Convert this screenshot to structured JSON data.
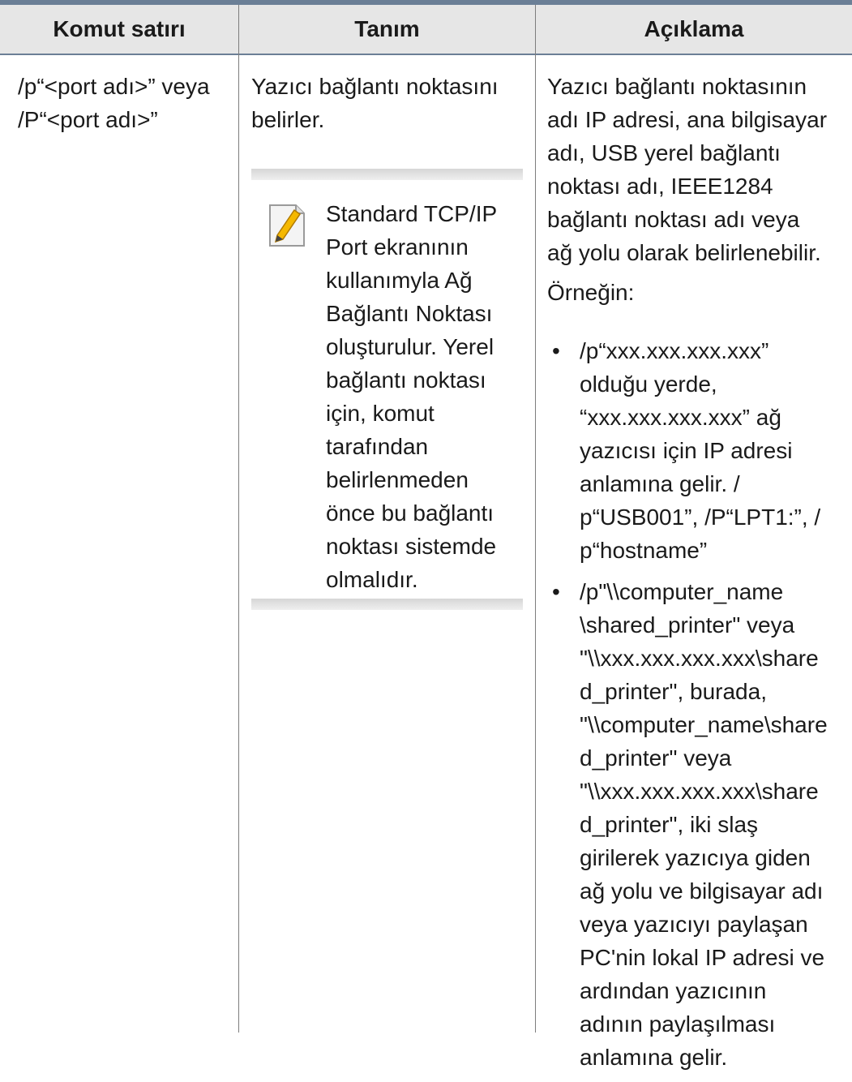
{
  "headers": [
    "Komut satırı",
    "Tanım",
    "Açıklama"
  ],
  "col1": [
    "/p“<port adı>” veya",
    "/P“<port adı>”"
  ],
  "col2": {
    "text": [
      "Yazıcı bağlantı noktasını",
      "belirler."
    ],
    "note": {
      "icon": "note-pencil-icon",
      "lines": [
        "Standard TCP/IP",
        "Port ekranının",
        "kullanımyla Ağ",
        "Bağlantı Noktası",
        "oluşturulur. Yerel",
        "bağlantı noktası",
        "için, komut",
        "tarafından",
        "belirlenmeden",
        "önce bu bağlantı",
        "noktası sistemde",
        "olmalıdır."
      ]
    }
  },
  "col3": {
    "desc": [
      "Yazıcı bağlantı noktasının",
      "adı IP adresi, ana bilgisayar",
      "adı, USB yerel bağlantı",
      "noktası adı, IEEE1284",
      "bağlantı noktası adı veya",
      "ağ yolu olarak belirlenebilir."
    ],
    "example_label": "Örneğin:",
    "bullets": [
      [
        "/p“xxx.xxx.xxx.xxx”",
        "olduğu yerde,",
        "“xxx.xxx.xxx.xxx” ağ",
        "yazıcısı için IP adresi",
        "anlamına gelir. /",
        "p“USB001”, /P“LPT1:”, /",
        "p“hostname”"
      ],
      [
        "/p\"\\\\computer_name",
        "\\shared_printer\" veya",
        "\"\\\\xxx.xxx.xxx.xxx\\share",
        "d_printer\", burada,",
        "\"\\\\computer_name\\share",
        "d_printer\" veya",
        "\"\\\\xxx.xxx.xxx.xxx\\share",
        "d_printer\", iki slaş",
        "girilerek yazıcıya giden",
        "ağ yolu ve bilgisayar adı",
        "veya yazıcıyı paylaşan",
        "PC'nin lokal IP adresi ve",
        "ardından yazıcının",
        "adının paylaşılması",
        "anlamına gelir."
      ]
    ],
    "bullet_symbol": "•"
  },
  "colors": {
    "rule": "#6b7f96",
    "header_bg": "#e6e6e6",
    "divider": "#7d7d7d"
  }
}
